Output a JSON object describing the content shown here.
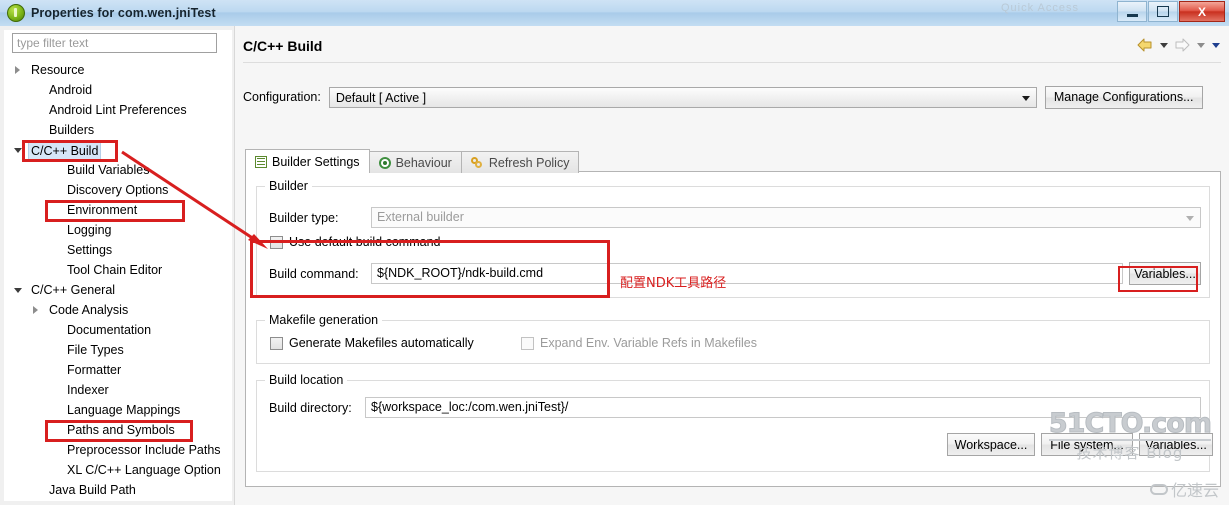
{
  "window": {
    "title": "Properties for com.wen.jniTest",
    "icon": "eclipse-circle-icon",
    "controls": {
      "minimize": "minimize-icon",
      "restore": "restore-icon",
      "close": "X"
    },
    "bg_hint": "Quick Access"
  },
  "sidebar": {
    "filter": {
      "placeholder": "type filter text",
      "value": ""
    },
    "items": [
      {
        "label": "Resource",
        "indent": 1,
        "twisty": "collapsed",
        "selected": false
      },
      {
        "label": "Android",
        "indent": 2,
        "twisty": "none",
        "selected": false
      },
      {
        "label": "Android Lint Preferences",
        "indent": 2,
        "twisty": "none",
        "selected": false
      },
      {
        "label": "Builders",
        "indent": 2,
        "twisty": "none",
        "selected": false
      },
      {
        "label": "C/C++ Build",
        "indent": 1,
        "twisty": "expanded",
        "selected": true
      },
      {
        "label": "Build Variables",
        "indent": 3,
        "twisty": "none",
        "selected": false
      },
      {
        "label": "Discovery Options",
        "indent": 3,
        "twisty": "none",
        "selected": false
      },
      {
        "label": "Environment",
        "indent": 3,
        "twisty": "none",
        "selected": false
      },
      {
        "label": "Logging",
        "indent": 3,
        "twisty": "none",
        "selected": false
      },
      {
        "label": "Settings",
        "indent": 3,
        "twisty": "none",
        "selected": false
      },
      {
        "label": "Tool Chain Editor",
        "indent": 3,
        "twisty": "none",
        "selected": false
      },
      {
        "label": "C/C++ General",
        "indent": 1,
        "twisty": "expanded",
        "selected": false
      },
      {
        "label": "Code Analysis",
        "indent": 2,
        "twisty": "collapsed",
        "selected": false
      },
      {
        "label": "Documentation",
        "indent": 3,
        "twisty": "none",
        "selected": false
      },
      {
        "label": "File Types",
        "indent": 3,
        "twisty": "none",
        "selected": false
      },
      {
        "label": "Formatter",
        "indent": 3,
        "twisty": "none",
        "selected": false
      },
      {
        "label": "Indexer",
        "indent": 3,
        "twisty": "none",
        "selected": false
      },
      {
        "label": "Language Mappings",
        "indent": 3,
        "twisty": "none",
        "selected": false
      },
      {
        "label": "Paths and Symbols",
        "indent": 3,
        "twisty": "none",
        "selected": false
      },
      {
        "label": "Preprocessor Include Paths",
        "indent": 3,
        "twisty": "none",
        "selected": false
      },
      {
        "label": "XL C/C++ Language Option",
        "indent": 3,
        "twisty": "none",
        "selected": false
      },
      {
        "label": "Java Build Path",
        "indent": 2,
        "twisty": "none",
        "selected": false
      }
    ]
  },
  "page": {
    "title": "C/C++ Build",
    "nav": {
      "back_icon": "back-arrow-icon",
      "back_menu_icon": "chevron-down-icon",
      "forward_icon": "forward-arrow-icon",
      "forward_menu_icon": "chevron-down-icon",
      "view_menu_icon": "chevron-down-icon"
    },
    "configuration": {
      "label": "Configuration:",
      "value": "Default  [ Active ]",
      "dropdown_icon": "chevron-down-icon",
      "manage_button": "Manage Configurations..."
    },
    "tabs": [
      {
        "label": "Builder Settings",
        "icon": "list-icon",
        "active": true
      },
      {
        "label": "Behaviour",
        "icon": "radio-icon",
        "active": false
      },
      {
        "label": "Refresh Policy",
        "icon": "refresh-icon",
        "active": false
      }
    ],
    "builder_group": {
      "title": "Builder",
      "builder_type_label": "Builder type:",
      "builder_type_value": "External builder",
      "builder_type_dropdown_icon": "chevron-down-icon",
      "use_default_label": "Use default build command",
      "use_default_checked": false,
      "build_command_label": "Build command:",
      "build_command_value": "${NDK_ROOT}/ndk-build.cmd",
      "variables_button": "Variables..."
    },
    "makefile_group": {
      "title": "Makefile generation",
      "generate_label": "Generate Makefiles automatically",
      "generate_checked": false,
      "expand_label": "Expand Env. Variable Refs in Makefiles",
      "expand_checked": false,
      "expand_disabled": true
    },
    "build_location_group": {
      "title": "Build location",
      "directory_label": "Build directory:",
      "directory_value": "${workspace_loc:/com.wen.jniTest}/",
      "workspace_button": "Workspace...",
      "filesystem_button": "File system...",
      "variables_button": "Variables..."
    }
  },
  "annotations": {
    "color": "#d81f1f",
    "note_text": "配置NDK工具路径",
    "boxes": [
      "C/C++ Build",
      "Environment",
      "Paths and Symbols",
      "Use default build command / Build command",
      "Variables..."
    ]
  },
  "watermarks": {
    "primary_main": "51CTO.com",
    "primary_sub_cn": "技术博客",
    "primary_sub_en": "Blog",
    "secondary": "亿速云",
    "secondary_icon": "cloud-icon"
  }
}
